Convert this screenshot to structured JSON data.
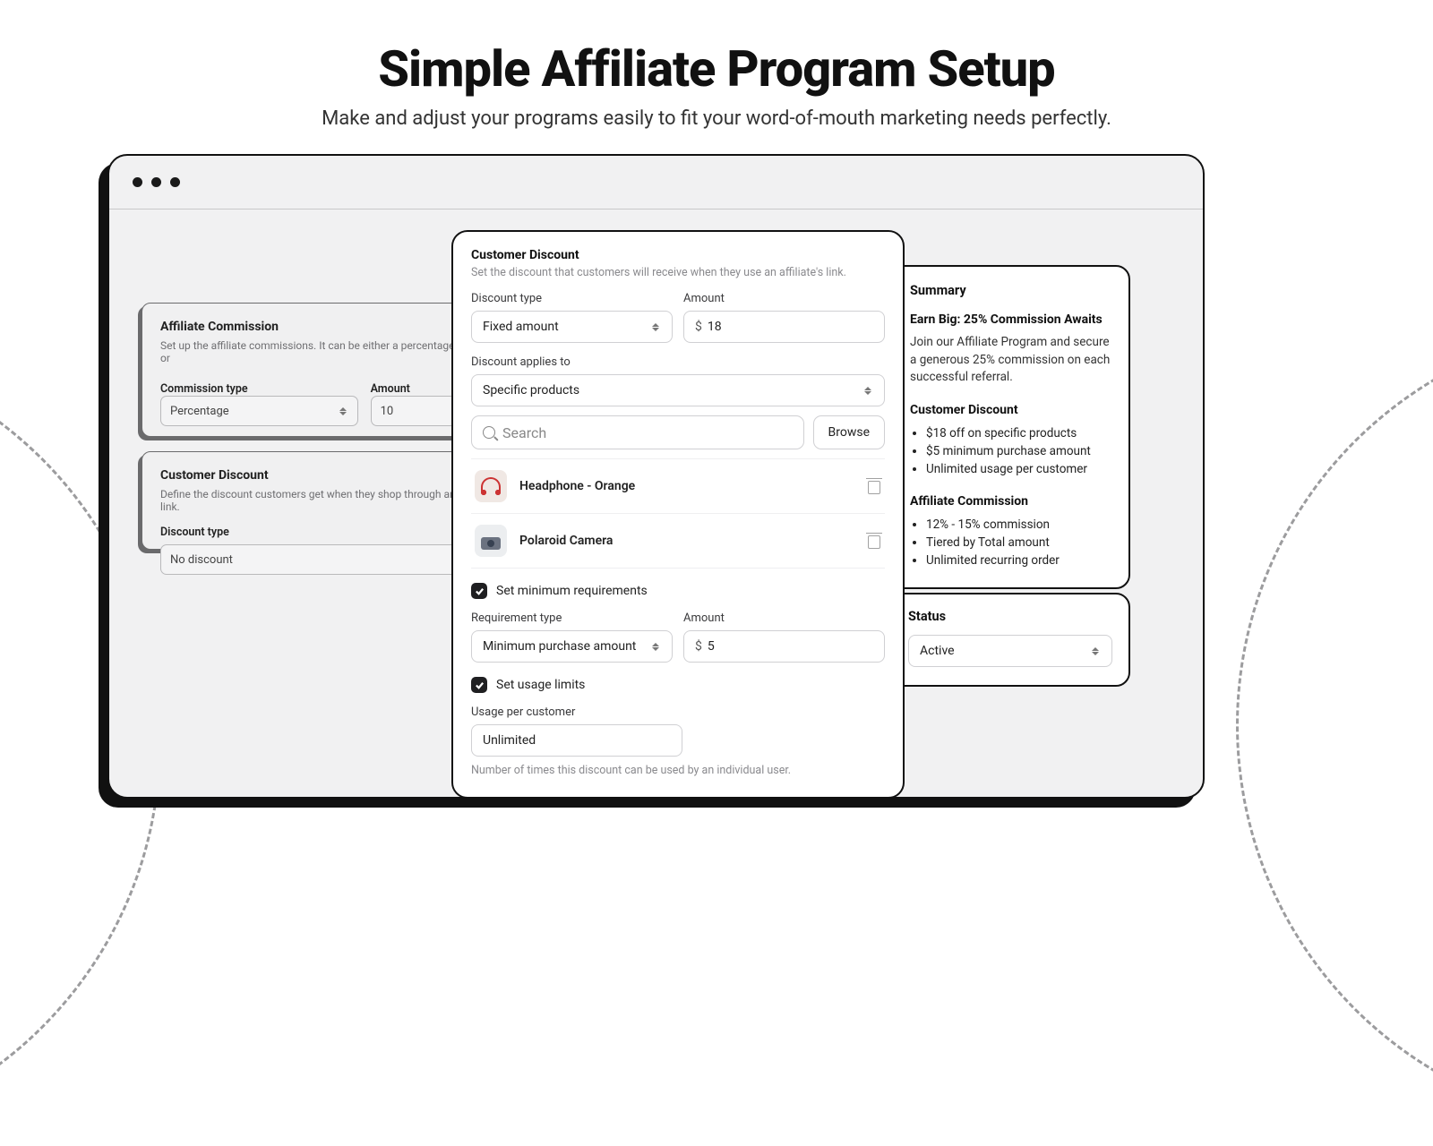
{
  "hero": {
    "title": "Simple Affiliate Program Setup",
    "subtitle": "Make and adjust your programs easily to fit your word-of-mouth marketing needs perfectly."
  },
  "bg_commission": {
    "title": "Affiliate Commission",
    "subtitle": "Set up the affiliate commissions. It can be either a percentage of the sale or",
    "type_label": "Commission type",
    "type_value": "Percentage",
    "amount_label": "Amount",
    "amount_value": "10"
  },
  "bg_discount": {
    "title": "Customer Discount",
    "subtitle": "Define the discount customers get when they shop through an affiliate's link.",
    "type_label": "Discount type",
    "type_value": "No discount"
  },
  "center": {
    "title": "Customer Discount",
    "subtitle": "Set the discount that customers will receive when they use an affiliate's link.",
    "discount_type_label": "Discount type",
    "discount_type_value": "Fixed amount",
    "amount_label": "Amount",
    "amount_prefix": "$",
    "amount_value": "18",
    "applies_label": "Discount applies to",
    "applies_value": "Specific products",
    "search_placeholder": "Search",
    "browse_label": "Browse",
    "products": [
      {
        "name": "Headphone - Orange"
      },
      {
        "name": "Polaroid Camera"
      }
    ],
    "min_req_label": "Set minimum requirements",
    "req_type_label": "Requirement type",
    "req_type_value": "Minimum purchase amount",
    "req_amount_label": "Amount",
    "req_amount_prefix": "$",
    "req_amount_value": "5",
    "usage_limits_label": "Set usage limits",
    "usage_per_customer_label": "Usage per customer",
    "usage_per_customer_value": "Unlimited",
    "usage_help": "Number of times this discount can be used by an individual user."
  },
  "summary": {
    "title": "Summary",
    "headline": "Earn Big: 25% Commission Awaits",
    "body": "Join our Affiliate Program and secure a generous 25% commission on each successful referral.",
    "cd_title": "Customer Discount",
    "cd_items": [
      "$18 off on specific products",
      "$5 minimum purchase amount",
      "Unlimited usage per customer"
    ],
    "ac_title": "Affiliate Commission",
    "ac_items": [
      "12% - 15% commission",
      "Tiered by Total amount",
      "Unlimited recurring order"
    ]
  },
  "status": {
    "title": "Status",
    "value": "Active"
  }
}
